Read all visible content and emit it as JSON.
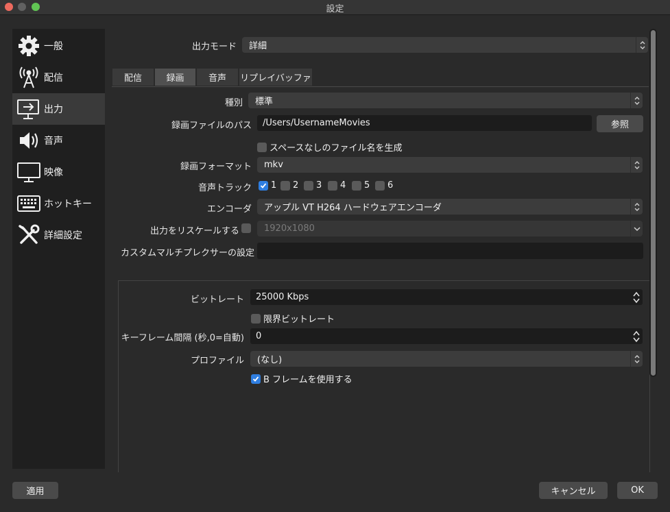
{
  "window": {
    "title": "設定"
  },
  "sidebar": {
    "items": [
      {
        "label": "一般",
        "icon": "gear-icon"
      },
      {
        "label": "配信",
        "icon": "broadcast-icon"
      },
      {
        "label": "出力",
        "icon": "output-monitor-icon",
        "active": true
      },
      {
        "label": "音声",
        "icon": "speaker-icon"
      },
      {
        "label": "映像",
        "icon": "display-icon"
      },
      {
        "label": "ホットキー",
        "icon": "keyboard-icon"
      },
      {
        "label": "詳細設定",
        "icon": "tools-icon"
      }
    ]
  },
  "output_mode": {
    "label": "出力モード",
    "value": "詳細"
  },
  "tabs": [
    {
      "label": "配信"
    },
    {
      "label": "録画",
      "active": true
    },
    {
      "label": "音声"
    },
    {
      "label": "リプレイバッファ"
    }
  ],
  "recording": {
    "type_label": "種別",
    "type_value": "標準",
    "path_label": "録画ファイルのパス",
    "path_value": "/Users/UsernameMovies",
    "browse_label": "参照",
    "no_space_label": "スペースなしのファイル名を生成",
    "format_label": "録画フォーマット",
    "format_value": "mkv",
    "audio_track_label": "音声トラック",
    "tracks": [
      {
        "label": "1",
        "checked": true
      },
      {
        "label": "2",
        "checked": false
      },
      {
        "label": "3",
        "checked": false
      },
      {
        "label": "4",
        "checked": false
      },
      {
        "label": "5",
        "checked": false
      },
      {
        "label": "6",
        "checked": false
      }
    ],
    "encoder_label": "エンコーダ",
    "encoder_value": "アップル VT H264 ハードウェアエンコーダ",
    "rescale_label": "出力をリスケールする",
    "rescale_value": "1920x1080",
    "muxer_label": "カスタムマルチプレクサーの設定",
    "muxer_value": ""
  },
  "encoder_settings": {
    "bitrate_label": "ビットレート",
    "bitrate_value": "25000 Kbps",
    "limit_bitrate_label": "限界ビットレート",
    "keyframe_label": "キーフレーム間隔 (秒,0=自動)",
    "keyframe_value": "0",
    "profile_label": "プロファイル",
    "profile_value": "(なし)",
    "bframes_label": "B フレームを使用する"
  },
  "footer": {
    "apply_label": "適用",
    "cancel_label": "キャンセル",
    "ok_label": "OK"
  },
  "colors": {
    "accent": "#2f7ee0",
    "background": "#2a2a2a",
    "sidebar": "#1f1f1f"
  }
}
